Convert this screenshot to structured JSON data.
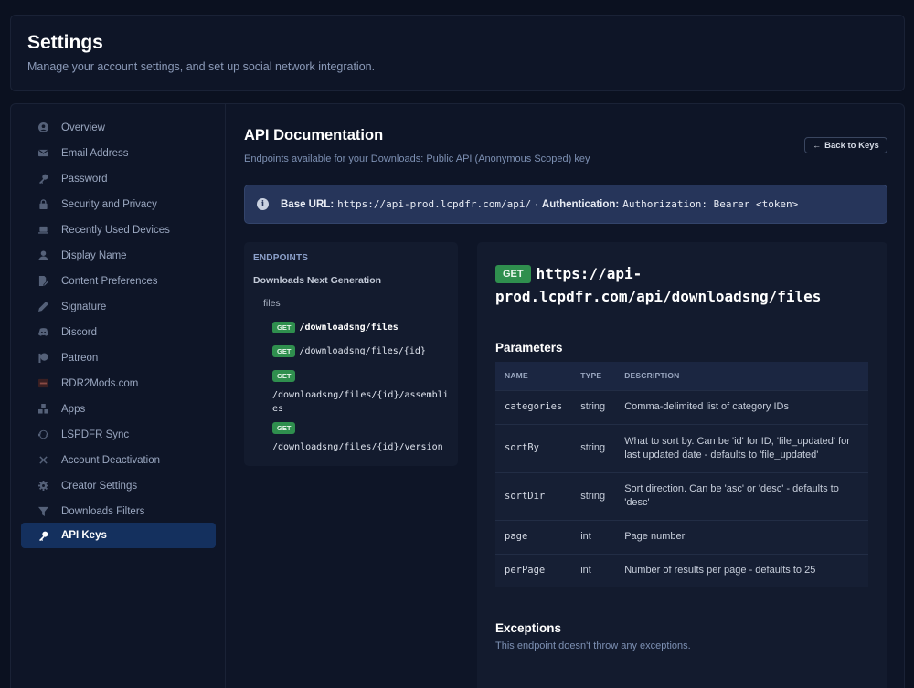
{
  "header": {
    "title": "Settings",
    "subtitle": "Manage your account settings, and set up social network integration."
  },
  "sidebar": {
    "items": [
      {
        "label": "Overview",
        "icon": "user-circle-icon"
      },
      {
        "label": "Email Address",
        "icon": "envelope-icon"
      },
      {
        "label": "Password",
        "icon": "key-icon"
      },
      {
        "label": "Security and Privacy",
        "icon": "lock-icon"
      },
      {
        "label": "Recently Used Devices",
        "icon": "laptop-icon"
      },
      {
        "label": "Display Name",
        "icon": "user-icon"
      },
      {
        "label": "Content Preferences",
        "icon": "file-pen-icon"
      },
      {
        "label": "Signature",
        "icon": "pen-icon"
      },
      {
        "label": "Discord",
        "icon": "discord-icon"
      },
      {
        "label": "Patreon",
        "icon": "patreon-icon"
      },
      {
        "label": "RDR2Mods.com",
        "icon": "rdr2mods-logo-icon"
      },
      {
        "label": "Apps",
        "icon": "cubes-icon"
      },
      {
        "label": "LSPDFR Sync",
        "icon": "sync-icon"
      },
      {
        "label": "Account Deactivation",
        "icon": "x-icon"
      },
      {
        "label": "Creator Settings",
        "icon": "gear-icon"
      },
      {
        "label": "Downloads Filters",
        "icon": "filter-icon"
      },
      {
        "label": "API Keys",
        "icon": "key-icon",
        "active": true
      }
    ]
  },
  "doc": {
    "title": "API Documentation",
    "subtitle": "Endpoints available for your Downloads: Public API (Anonymous Scoped) key",
    "back_label": "Back to Keys",
    "base_url_label": "Base URL:",
    "base_url": "https://api-prod.lcpdfr.com/api/",
    "separator": "·",
    "auth_label": "Authentication:",
    "auth_value": "Authorization: Bearer <token>"
  },
  "endpoints": {
    "heading": "ENDPOINTS",
    "group": "Downloads Next Generation",
    "subgroup": "files",
    "method": "GET",
    "items": [
      "/downloadsng/files",
      "/downloadsng/files/{id}",
      "/downloadsng/files/{id}/assemblies",
      "/downloadsng/files/{id}/version"
    ]
  },
  "detail": {
    "method": "GET",
    "url": "https://api-prod.lcpdfr.com/api/downloadsng/files",
    "params_title": "Parameters",
    "columns": [
      "NAME",
      "TYPE",
      "DESCRIPTION"
    ],
    "rows": [
      {
        "name": "categories",
        "type": "string",
        "desc": "Comma-delimited list of category IDs"
      },
      {
        "name": "sortBy",
        "type": "string",
        "desc": "What to sort by. Can be 'id' for ID, 'file_updated' for last updated date - defaults to 'file_updated'"
      },
      {
        "name": "sortDir",
        "type": "string",
        "desc": "Sort direction. Can be 'asc' or 'desc' - defaults to 'desc'"
      },
      {
        "name": "page",
        "type": "int",
        "desc": "Page number"
      },
      {
        "name": "perPage",
        "type": "int",
        "desc": "Number of results per page - defaults to 25"
      }
    ],
    "exceptions_title": "Exceptions",
    "exceptions_text": "This endpoint doesn't throw any exceptions."
  }
}
